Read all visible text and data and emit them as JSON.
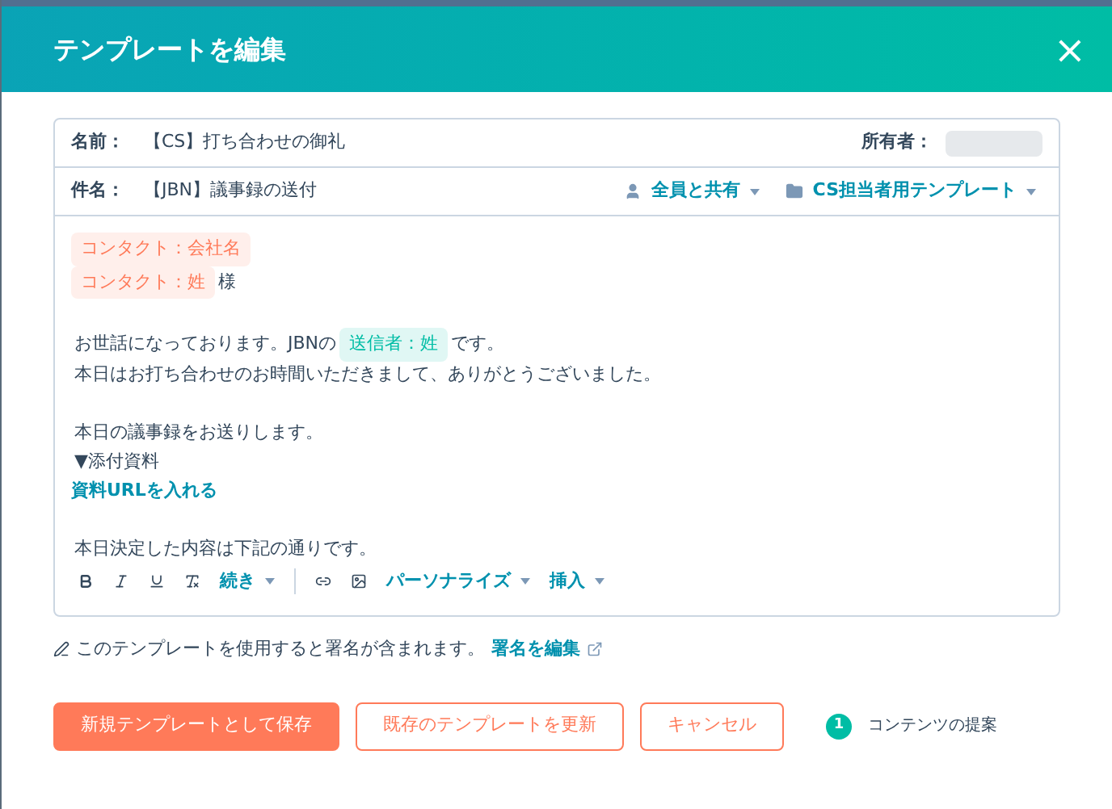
{
  "dialog": {
    "title": "テンプレートを編集",
    "close": "×"
  },
  "name_row": {
    "label": "名前：",
    "value": "【CS】打ち合わせの御礼",
    "owner_label": "所有者："
  },
  "subject_row": {
    "label": "件名：",
    "value": "【JBN】議事録の送付",
    "share": "全員と共有",
    "folder": "CS担当者用テンプレート"
  },
  "body": [
    [
      [
        {
          "kind": "token",
          "text": "コンタクト：会社名",
          "color": "#ff7a59"
        }
      ],
      [
        {
          "kind": "token",
          "text": "コンタクト：姓",
          "color": "#ff7a59"
        },
        {
          "kind": "text",
          "text": "様"
        }
      ]
    ],
    [
      [
        {
          "kind": "text",
          "text": "お世話になっております。JBNの"
        },
        {
          "kind": "token",
          "text": "送信者：姓",
          "color": "#00bda5"
        },
        {
          "kind": "text",
          "text": "です。"
        }
      ],
      [
        {
          "kind": "text",
          "text": "本日はお打ち合わせのお時間いただきまして、ありがとうございました。"
        }
      ]
    ],
    [
      [
        {
          "kind": "text",
          "text": "本日の議事録をお送りします。"
        }
      ],
      [
        {
          "kind": "text",
          "text": "▼添付資料"
        }
      ],
      [
        {
          "kind": "link",
          "text": "資料URLを入れる"
        }
      ]
    ],
    [
      [
        {
          "kind": "text",
          "text": "本日決定した内容は下記の通りです。"
        }
      ]
    ]
  ],
  "toolbar": {
    "more": "続き",
    "personalize": "パーソナライズ",
    "insert": "挿入"
  },
  "signature": {
    "text": "このテンプレートを使用すると署名が含まれます。",
    "link": "署名を編集"
  },
  "buttons": [
    {
      "kind": "primary",
      "label": "新規テンプレートとして保存"
    },
    {
      "kind": "secondary",
      "label": "既存のテンプレートを更新"
    },
    {
      "kind": "secondary",
      "label": "キャンセル"
    }
  ],
  "suggestion": {
    "count": "1",
    "label": "コンテンツの提案"
  }
}
